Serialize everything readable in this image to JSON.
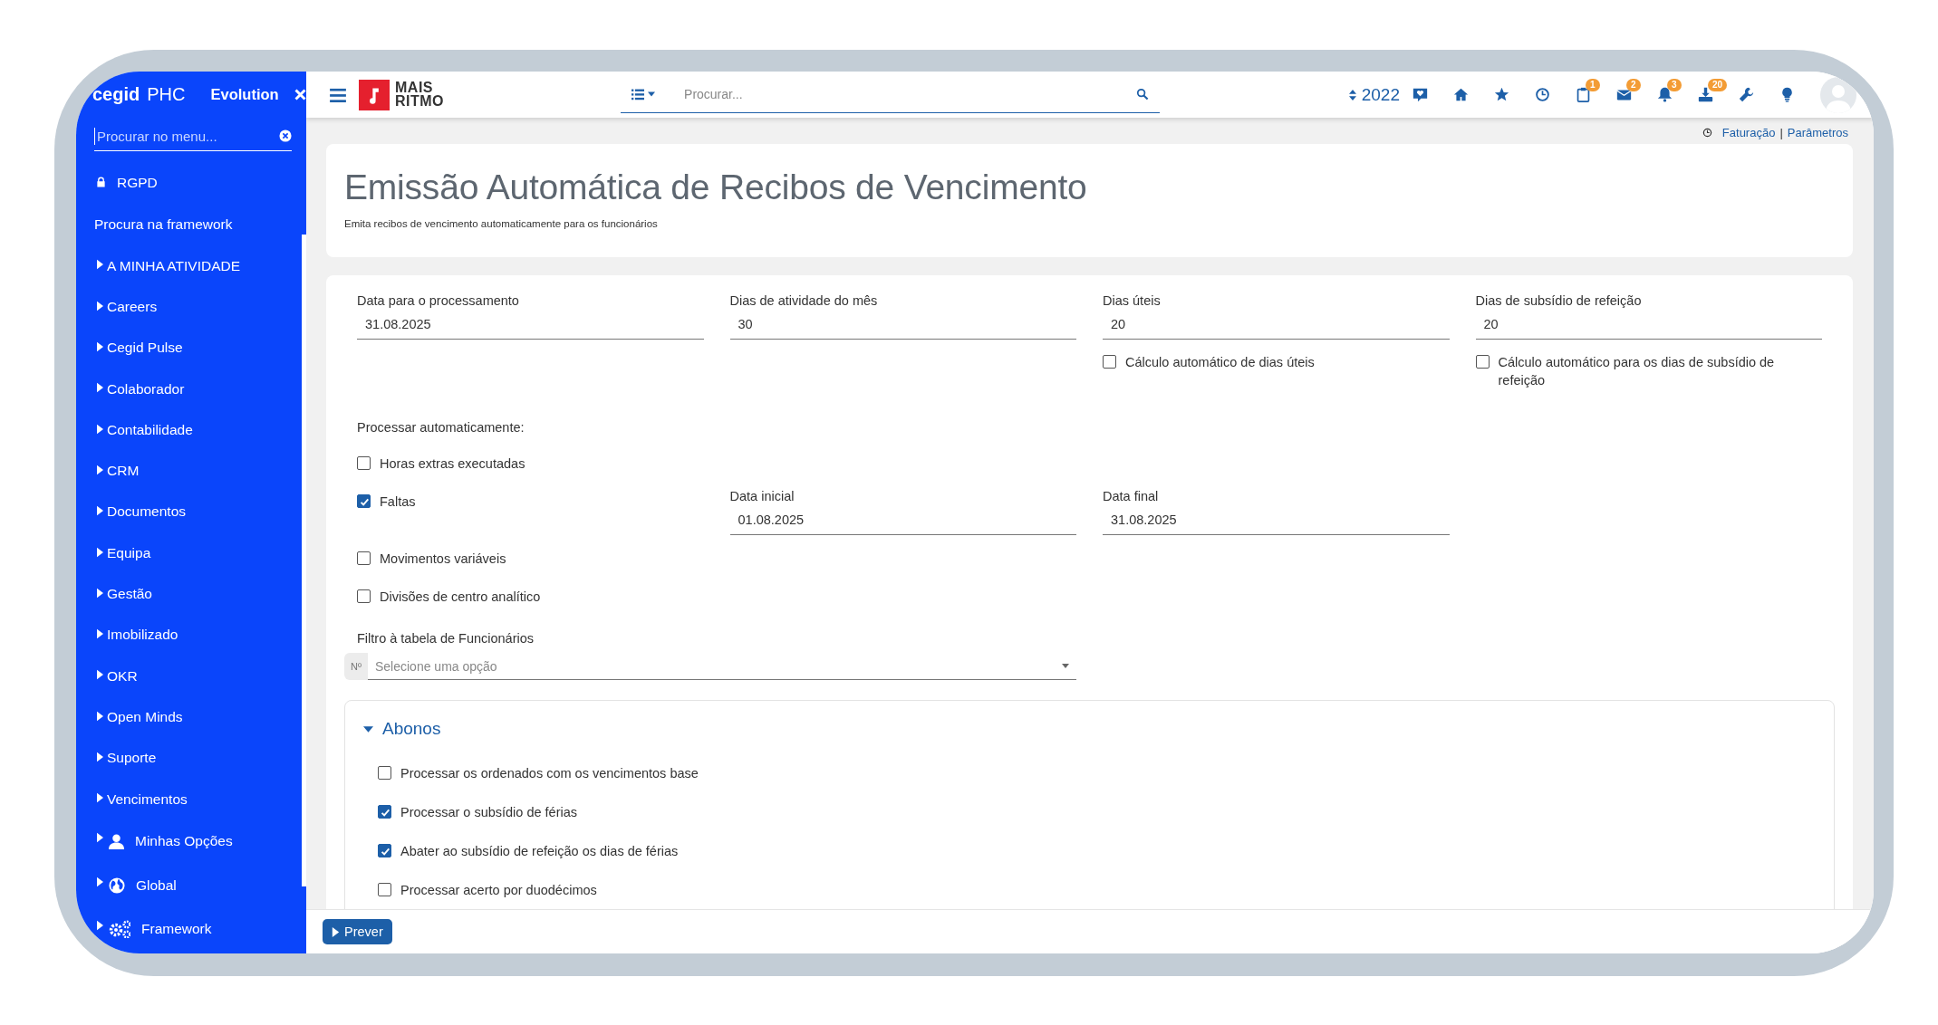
{
  "sidebar": {
    "brand": "cegid",
    "product": "PHC",
    "edition": "Evolution",
    "search": {
      "placeholder": "Procurar no menu..."
    },
    "items": [
      {
        "label": "RGPD",
        "kind": "lock"
      },
      {
        "label": "Procura na framework",
        "kind": "link"
      },
      {
        "label": "A MINHA ATIVIDADE",
        "kind": "group"
      },
      {
        "label": "Careers",
        "kind": "group"
      },
      {
        "label": "Cegid Pulse",
        "kind": "group"
      },
      {
        "label": "Colaborador",
        "kind": "group"
      },
      {
        "label": "Contabilidade",
        "kind": "group"
      },
      {
        "label": "CRM",
        "kind": "group"
      },
      {
        "label": "Documentos",
        "kind": "group"
      },
      {
        "label": "Equipa",
        "kind": "group"
      },
      {
        "label": "Gestão",
        "kind": "group"
      },
      {
        "label": "Imobilizado",
        "kind": "group"
      },
      {
        "label": "OKR",
        "kind": "group"
      },
      {
        "label": "Open Minds",
        "kind": "group"
      },
      {
        "label": "Suporte",
        "kind": "group"
      },
      {
        "label": "Vencimentos",
        "kind": "group"
      },
      {
        "label": "Minhas Opções",
        "kind": "user"
      },
      {
        "label": "Global",
        "kind": "globe"
      },
      {
        "label": "Framework",
        "kind": "gears"
      }
    ]
  },
  "topbar": {
    "logo": [
      "MAIS",
      "RITMO"
    ],
    "search": {
      "placeholder": "Procurar..."
    },
    "year": "2022",
    "icons": [
      {
        "kind": "chat"
      },
      {
        "kind": "home"
      },
      {
        "kind": "star"
      },
      {
        "kind": "clock"
      },
      {
        "kind": "clipboard",
        "badge": "1"
      },
      {
        "kind": "mail",
        "badge": "2"
      },
      {
        "kind": "bell",
        "badge": "3"
      },
      {
        "kind": "inbox",
        "badge": "20"
      },
      {
        "kind": "wrench"
      },
      {
        "kind": "bulb"
      }
    ]
  },
  "breadcrumb": {
    "links": [
      "Faturação",
      "Parâmetros"
    ],
    "separator": "|"
  },
  "page": {
    "title": "Emissão Automática de Recibos de Vencimento",
    "subtitle": "Emita recibos de vencimento automaticamente para os funcionários"
  },
  "fields": [
    {
      "label": "Data para o processamento",
      "value": "31.08.2025"
    },
    {
      "label": "Dias de atividade do mês",
      "value": "30"
    },
    {
      "label": "Dias úteis",
      "value": "20",
      "option": {
        "label": "Cálculo automático de dias úteis",
        "checked": false
      }
    },
    {
      "label": "Dias de subsídio de refeição",
      "value": "20",
      "option": {
        "label": "Cálculo automático para os dias de subsídio de refeição",
        "checked": false
      }
    }
  ],
  "process": {
    "label": "Processar automaticamente:",
    "options": [
      {
        "label": "Horas extras executadas",
        "checked": false
      },
      {
        "label": "Faltas",
        "checked": true,
        "dates": [
          {
            "label": "Data inicial",
            "value": "01.08.2025"
          },
          {
            "label": "Data final",
            "value": "31.08.2025"
          }
        ]
      },
      {
        "label": "Movimentos variáveis",
        "checked": false
      },
      {
        "label": "Divisões de centro analítico",
        "checked": false
      }
    ]
  },
  "filter": {
    "label": "Filtro à tabela de Funcionários",
    "prefix": "Nº",
    "placeholder": "Selecione uma opção"
  },
  "abonos": {
    "title": "Abonos",
    "expanded": true,
    "options": [
      {
        "label": "Processar os ordenados com os vencimentos base",
        "checked": false
      },
      {
        "label": "Processar o subsídio de férias",
        "checked": true
      },
      {
        "label": "Abater ao subsídio de refeição os dias de férias",
        "checked": true
      },
      {
        "label": "Processar acerto por duodécimos",
        "checked": false
      }
    ]
  },
  "footer": {
    "button": "Prever"
  }
}
